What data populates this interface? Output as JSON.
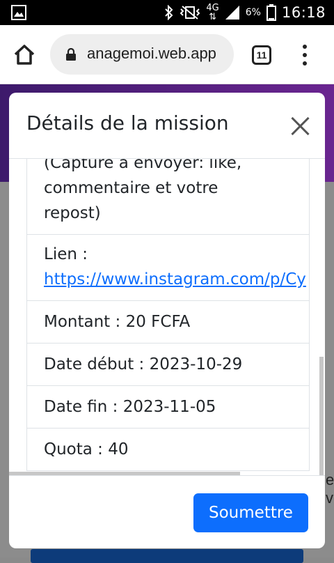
{
  "status_bar": {
    "network": "4G",
    "battery": "6%",
    "time": "16:18"
  },
  "browser": {
    "url": "anagemoi.web.app",
    "tab_count": "11"
  },
  "page": {
    "behind_text": "e v"
  },
  "modal": {
    "title": "Détails de la mission",
    "description": "(Capture à envoyer: like, commentaire et votre repost)",
    "link_label": "Lien :",
    "link_url": "https://www.instagram.com/p/Cy",
    "amount": "Montant : 20 FCFA",
    "start_date": "Date début : 2023-10-29",
    "end_date": "Date fin : 2023-11-05",
    "quota": "Quota : 40",
    "submit_label": "Soumettre"
  }
}
